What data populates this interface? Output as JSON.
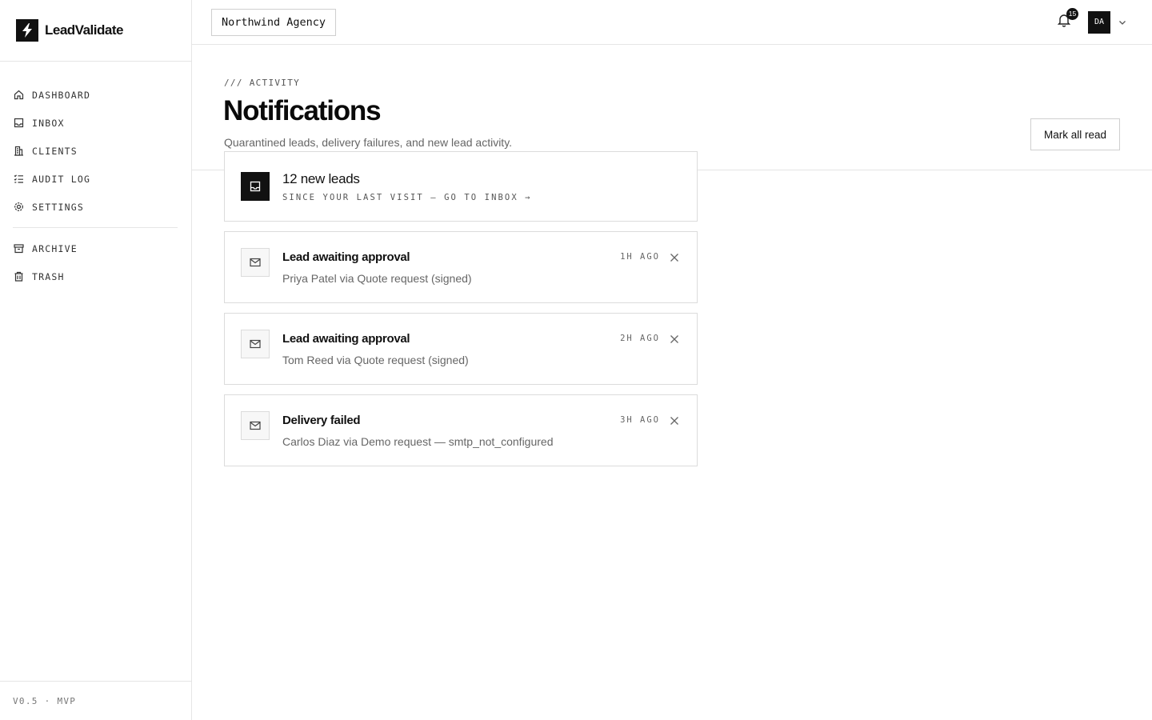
{
  "brand": {
    "name": "LeadValidate",
    "logo_icon": "bolt-icon"
  },
  "sidebar": {
    "items": [
      {
        "label": "DASHBOARD",
        "icon": "home-icon"
      },
      {
        "label": "INBOX",
        "icon": "inbox-icon"
      },
      {
        "label": "CLIENTS",
        "icon": "building-icon"
      },
      {
        "label": "AUDIT LOG",
        "icon": "list-checks-icon"
      },
      {
        "label": "SETTINGS",
        "icon": "gear-icon"
      }
    ],
    "secondary": [
      {
        "label": "ARCHIVE",
        "icon": "archive-icon"
      },
      {
        "label": "TRASH",
        "icon": "trash-icon"
      }
    ],
    "version": "V0.5 · MVP"
  },
  "topbar": {
    "workspace": "Northwind Agency",
    "notification_count": "15",
    "avatar_initials": "DA"
  },
  "header": {
    "eyebrow": "/// ACTIVITY",
    "title": "Notifications",
    "subtitle": "Quarantined leads, delivery failures, and new lead activity.",
    "mark_all_read": "Mark all read"
  },
  "summary": {
    "title": "12 new leads",
    "link": "SINCE YOUR LAST VISIT — GO TO INBOX →"
  },
  "notifications": [
    {
      "title": "Lead awaiting approval",
      "description": "Priya Patel via Quote request (signed)",
      "time": "1H AGO"
    },
    {
      "title": "Lead awaiting approval",
      "description": "Tom Reed via Quote request (signed)",
      "time": "2H AGO"
    },
    {
      "title": "Delivery failed",
      "description": "Carlos Diaz via Demo request — smtp_not_configured",
      "time": "3H AGO"
    }
  ],
  "colors": {
    "accent": "#111111",
    "border": "#e5e5e5",
    "muted_text": "#666666"
  }
}
